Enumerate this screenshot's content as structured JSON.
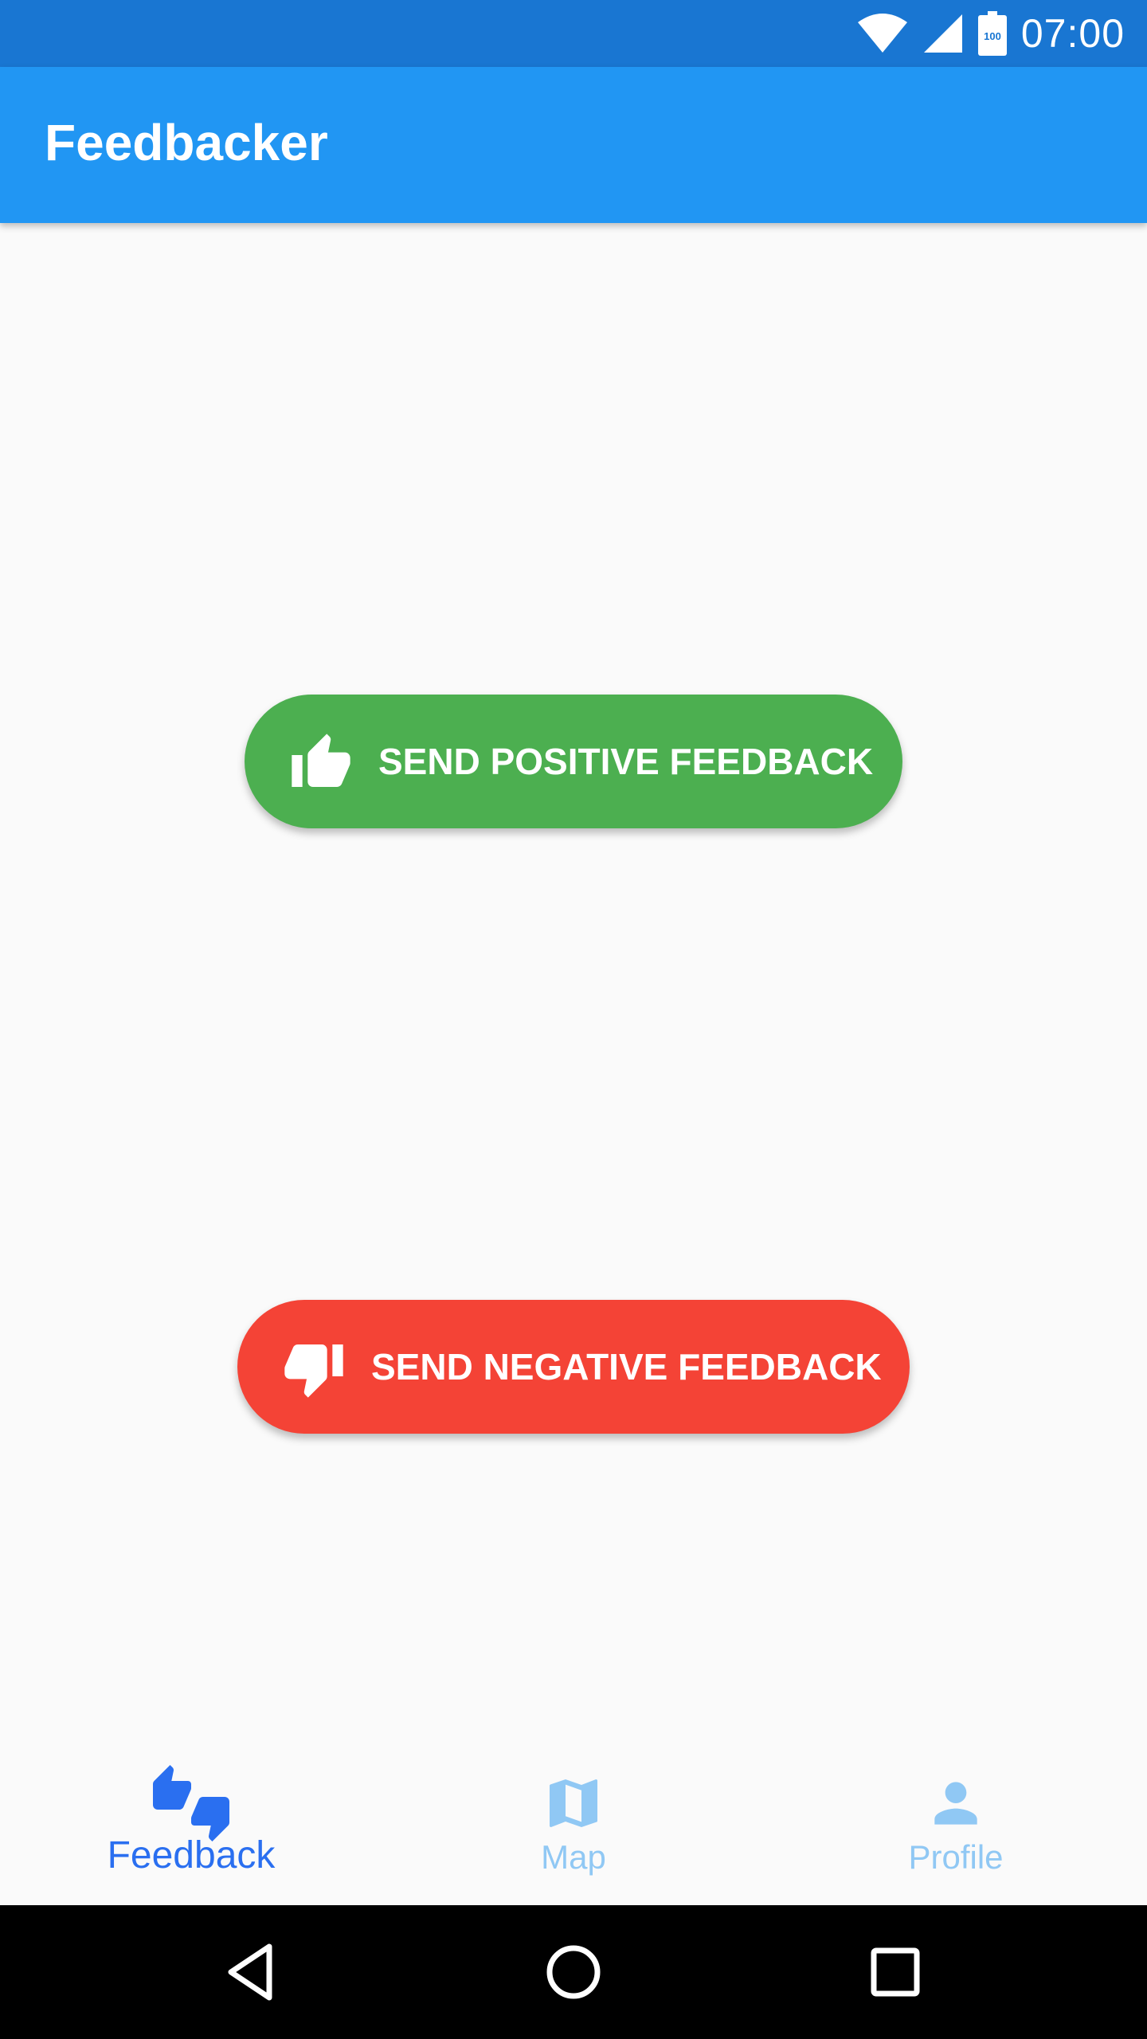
{
  "status_bar": {
    "time": "07:00",
    "battery_level": "100",
    "icons": [
      "wifi-icon",
      "signal-icon",
      "battery-icon"
    ]
  },
  "app_bar": {
    "title": "Feedbacker"
  },
  "main": {
    "positive_button": {
      "label": "SEND POSITIVE FEEDBACK",
      "icon": "thumb-up-icon",
      "color": "#4caf50"
    },
    "negative_button": {
      "label": "SEND NEGATIVE FEEDBACK",
      "icon": "thumb-down-icon",
      "color": "#f44336"
    }
  },
  "bottom_nav": {
    "items": [
      {
        "label": "Feedback",
        "icon": "thumbs-up-down-icon",
        "active": true
      },
      {
        "label": "Map",
        "icon": "map-icon",
        "active": false
      },
      {
        "label": "Profile",
        "icon": "person-icon",
        "active": false
      }
    ],
    "active_color": "#2a6ff0",
    "inactive_color": "#90c8f4"
  },
  "colors": {
    "status_bar": "#1976d2",
    "app_bar": "#2196f3",
    "background": "#fafafa"
  },
  "system_nav": {
    "buttons": [
      "back-icon",
      "home-icon",
      "recents-icon"
    ]
  }
}
